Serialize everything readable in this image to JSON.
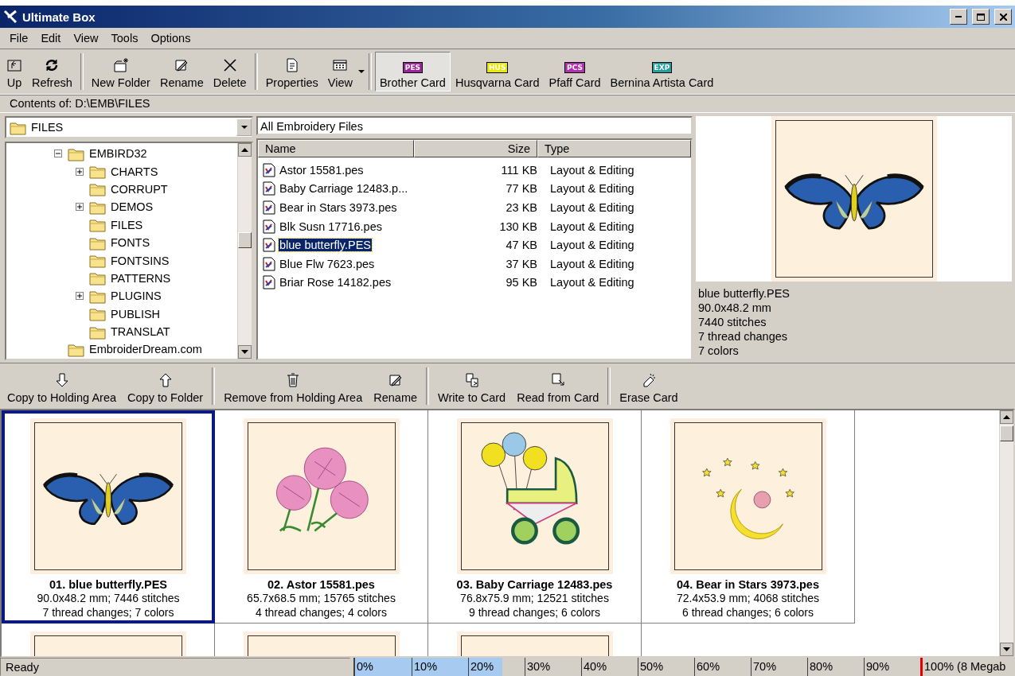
{
  "window": {
    "title": "Ultimate Box"
  },
  "menu": [
    "File",
    "Edit",
    "View",
    "Tools",
    "Options"
  ],
  "toolbar": [
    [
      {
        "label": "Up",
        "kind": "up"
      },
      {
        "label": "Refresh",
        "kind": "refresh"
      }
    ],
    [
      {
        "label": "New Folder",
        "kind": "newfolder"
      },
      {
        "label": "Rename",
        "kind": "rename"
      },
      {
        "label": "Delete",
        "kind": "delete"
      }
    ],
    [
      {
        "label": "Properties",
        "kind": "properties"
      },
      {
        "label": "View",
        "kind": "view",
        "dropdown": true
      }
    ],
    [
      {
        "label": "Brother Card",
        "kind": "card",
        "badge": "PES",
        "color": "#a020a0",
        "selected": true
      },
      {
        "label": "Husqvarna Card",
        "kind": "card",
        "badge": "HUS",
        "color": "#e8e800",
        "selected": false
      },
      {
        "label": "Pfaff Card",
        "kind": "card",
        "badge": "PCS",
        "color": "#b030b0",
        "selected": false
      },
      {
        "label": "Bernina Artista Card",
        "kind": "card",
        "badge": "EXP",
        "color": "#20a0a0",
        "selected": false
      }
    ]
  ],
  "path_bar": "Contents of: D:\\EMB\\FILES",
  "folder_combo": {
    "value": "FILES"
  },
  "filter_combo": {
    "value": "All Embroidery Files"
  },
  "tree": [
    {
      "label": "EMBIRD32",
      "expanded": true,
      "children": [
        {
          "label": "CHARTS",
          "expanded": false
        },
        {
          "label": "CORRUPT"
        },
        {
          "label": "DEMOS",
          "expanded": false
        },
        {
          "label": "FILES"
        },
        {
          "label": "FONTS"
        },
        {
          "label": "FONTSINS"
        },
        {
          "label": "PATTERNS"
        },
        {
          "label": "PLUGINS",
          "expanded": false
        },
        {
          "label": "PUBLISH"
        },
        {
          "label": "TRANSLAT"
        }
      ]
    },
    {
      "label": "EmbroiderDream.com"
    }
  ],
  "file_list": {
    "columns": [
      "Name",
      "Size",
      "Type"
    ],
    "rows": [
      {
        "name": "Astor 15581.pes",
        "size": "111 KB",
        "type": "Layout & Editing",
        "selected": false
      },
      {
        "name": "Baby Carriage 12483.p...",
        "size": "77 KB",
        "type": "Layout & Editing",
        "selected": false
      },
      {
        "name": "Bear in Stars 3973.pes",
        "size": "23 KB",
        "type": "Layout & Editing",
        "selected": false
      },
      {
        "name": "Blk Susn 17716.pes",
        "size": "130 KB",
        "type": "Layout & Editing",
        "selected": false
      },
      {
        "name": "blue butterfly.PES",
        "size": "47 KB",
        "type": "Layout & Editing",
        "selected": true
      },
      {
        "name": "Blue Flw 7623.pes",
        "size": "37 KB",
        "type": "Layout & Editing",
        "selected": false
      },
      {
        "name": "Briar Rose 14182.pes",
        "size": "95 KB",
        "type": "Layout & Editing",
        "selected": false
      }
    ]
  },
  "preview": {
    "kind": "butterfly",
    "lines": [
      "blue butterfly.PES",
      "90.0x48.2 mm",
      "7440 stitches",
      "7 thread changes",
      "7 colors"
    ]
  },
  "holding_toolbar": [
    [
      {
        "label": "Copy to Holding Area",
        "kind": "down"
      },
      {
        "label": "Copy to Folder",
        "kind": "up-arrow"
      }
    ],
    [
      {
        "label": "Remove from Holding Area",
        "kind": "trash"
      },
      {
        "label": "Rename",
        "kind": "rename"
      }
    ],
    [
      {
        "label": "Write to Card",
        "kind": "write"
      },
      {
        "label": "Read from Card",
        "kind": "read"
      }
    ],
    [
      {
        "label": "Erase Card",
        "kind": "erase"
      }
    ]
  ],
  "thumbnails": [
    {
      "kind": "butterfly",
      "title": "01. blue butterfly.PES",
      "line1": "90.0x48.2 mm; 7446 stitches",
      "line2": "7 thread changes; 7 colors",
      "selected": true
    },
    {
      "kind": "flowers",
      "title": "02. Astor 15581.pes",
      "line1": "65.7x68.5 mm; 15765 stitches",
      "line2": "4 thread changes; 4 colors",
      "selected": false
    },
    {
      "kind": "carriage",
      "title": "03. Baby Carriage 12483.pes",
      "line1": "76.8x75.9 mm; 12521 stitches",
      "line2": "9 thread changes; 6 colors",
      "selected": false
    },
    {
      "kind": "moon",
      "title": "04. Bear in Stars 3973.pes",
      "line1": "72.4x53.9 mm; 4068 stitches",
      "line2": "6 thread changes; 6 colors",
      "selected": false
    },
    {
      "kind": "blank",
      "selected": false
    },
    {
      "kind": "blank",
      "selected": false
    },
    {
      "kind": "blank",
      "selected": false
    }
  ],
  "status_bar": {
    "text": "Ready",
    "meter": {
      "labels": [
        "0%",
        "10%",
        "20%",
        "30%",
        "40%",
        "50%",
        "60%",
        "70%",
        "80%",
        "90%",
        "100% (8 Megab"
      ],
      "level": 0.26
    }
  }
}
